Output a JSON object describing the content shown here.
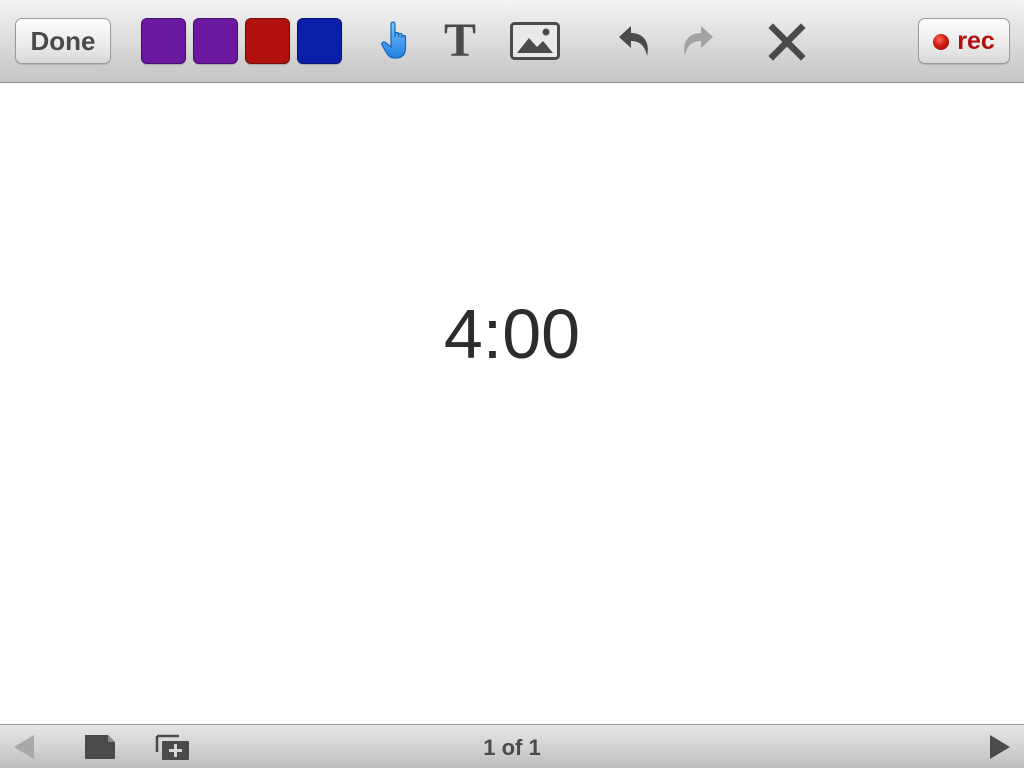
{
  "toolbar": {
    "done_label": "Done",
    "rec_label": "rec",
    "swatches": [
      {
        "name": "purple",
        "color": "#6a17a2"
      },
      {
        "name": "purple",
        "color": "#6a17a2"
      },
      {
        "name": "red",
        "color": "#b0110f"
      },
      {
        "name": "blue",
        "color": "#0a1fa8"
      }
    ],
    "tools": [
      {
        "icon": "hand-pointer-icon",
        "active": true
      },
      {
        "icon": "text-tool-icon"
      },
      {
        "icon": "image-icon"
      },
      {
        "icon": "undo-icon"
      },
      {
        "icon": "redo-icon",
        "disabled": true
      },
      {
        "icon": "close-icon"
      }
    ],
    "text_tool_glyph": "T"
  },
  "canvas": {
    "text": "4:00"
  },
  "bottombar": {
    "page_counter": "1 of 1",
    "icons": [
      "previous-page-icon",
      "page-icon",
      "add-page-icon",
      "next-page-icon"
    ]
  },
  "colors": {
    "accent": "#2a8df0",
    "rec": "#b30f0f"
  }
}
